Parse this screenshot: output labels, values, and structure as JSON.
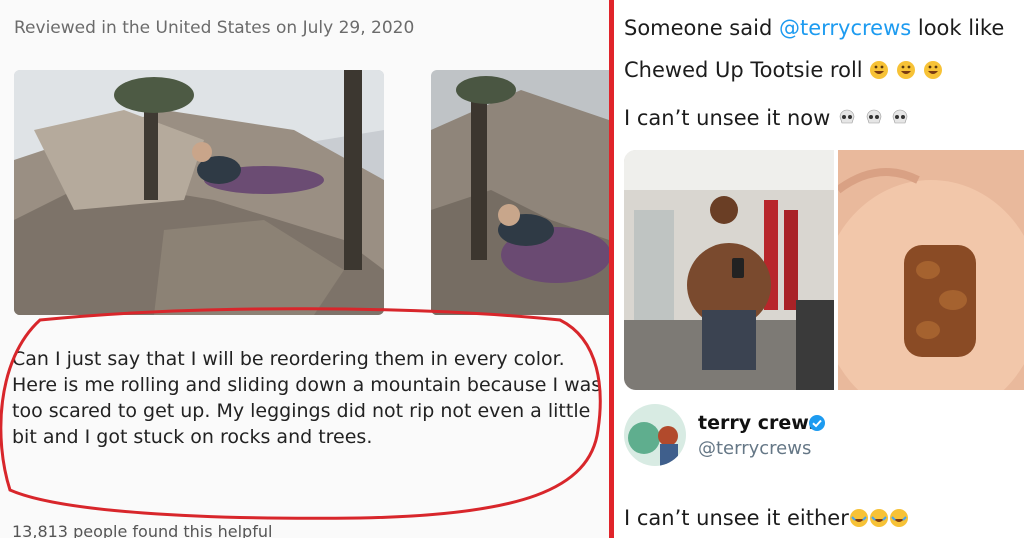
{
  "review": {
    "date_line": "Reviewed in the United States on July 29, 2020",
    "text": "Can I just say that I will be reordering them in every color. Here is me rolling and sliding down a mountain because I was too scared to get up. My leggings did not rip not even a little bit and I got stuck on rocks and trees.",
    "helpful_line": "13,813 people found this helpful"
  },
  "tweet": {
    "line1_prefix": "Someone said ",
    "mention": "@terrycrews",
    "line1_suffix": " look like",
    "line2": "Chewed Up Tootsie roll ",
    "line3": "I can’t unsee it now ",
    "line2_emoji": "rofl-emoji",
    "line3_emoji": "skull-emoji"
  },
  "reply": {
    "name": "terry crews",
    "handle": "@terrycrews",
    "text": "I can’t unsee it either",
    "emoji": "joy-emoji"
  },
  "colors": {
    "divider": "#e0242a",
    "annotation_circle": "#d8262b",
    "mention": "#1d9bf0",
    "verified": "#1d9bf0"
  }
}
